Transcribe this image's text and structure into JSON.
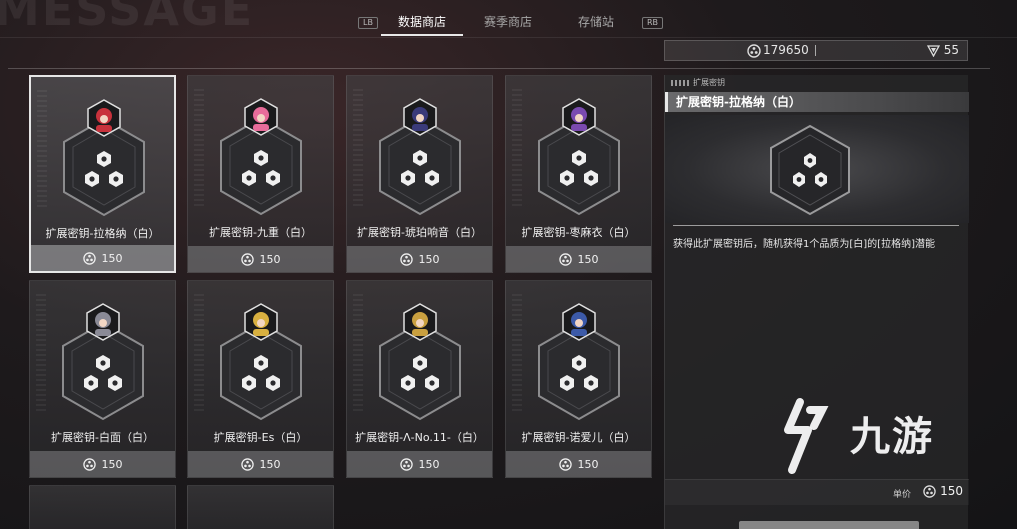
{
  "background_text": "MESSAGE",
  "tabs": {
    "lb": "LB",
    "rb": "RB",
    "items": [
      {
        "label": "数据商店",
        "active": true
      },
      {
        "label": "赛季商店",
        "active": false
      },
      {
        "label": "存储站",
        "active": false
      }
    ]
  },
  "currency": {
    "primary_icon": "data-chip-icon",
    "primary_value": "179650",
    "secondary_icon": "gem-shield-icon",
    "secondary_value": "55"
  },
  "items": [
    {
      "name": "扩展密钥-拉格纳（白）",
      "price": "150",
      "selected": true,
      "portrait_color": "#c8323c"
    },
    {
      "name": "扩展密钥-九重（白）",
      "price": "150",
      "selected": false,
      "portrait_color": "#e86c9a"
    },
    {
      "name": "扩展密钥-琥珀响音（白）",
      "price": "150",
      "selected": false,
      "portrait_color": "#3a3a7a"
    },
    {
      "name": "扩展密钥-枣麻衣（白）",
      "price": "150",
      "selected": false,
      "portrait_color": "#7a4ab0"
    },
    {
      "name": "扩展密钥-白面（白）",
      "price": "150",
      "selected": false,
      "portrait_color": "#8a8a96"
    },
    {
      "name": "扩展密钥-Es（白）",
      "price": "150",
      "selected": false,
      "portrait_color": "#d8b040"
    },
    {
      "name": "扩展密钥-Λ-No.11-（白）",
      "price": "150",
      "selected": false,
      "portrait_color": "#c9a040"
    },
    {
      "name": "扩展密钥-诺爱儿（白）",
      "price": "150",
      "selected": false,
      "portrait_color": "#3c5aa8"
    }
  ],
  "detail": {
    "category": "扩展密钥",
    "title": "扩展密钥-拉格纳（白）",
    "description": "获得此扩展密钥后，随机获得1个品质为[白]的[拉格纳]潜能",
    "unit_label": "单价",
    "unit_price": "150"
  },
  "watermark": {
    "text": "九游"
  },
  "colors": {
    "accent": "#e8e8e8",
    "panel": "#2d2d30",
    "price_bar": "#828284"
  }
}
